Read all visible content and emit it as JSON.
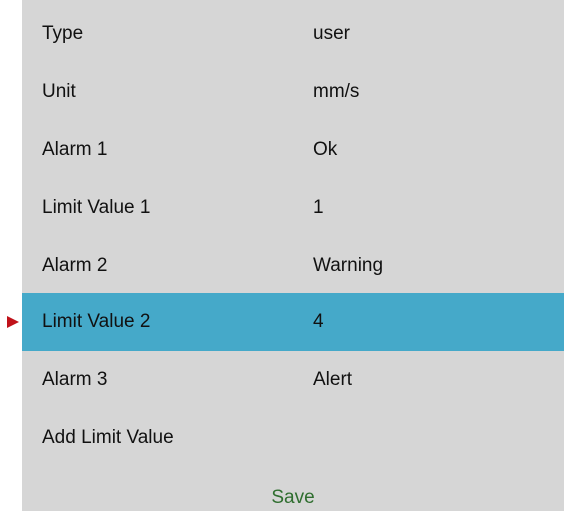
{
  "rows": [
    {
      "label": "Type",
      "value": "user"
    },
    {
      "label": "Unit",
      "value": "mm/s"
    },
    {
      "label": "Alarm 1",
      "value": "Ok"
    },
    {
      "label": "Limit Value 1",
      "value": "1"
    },
    {
      "label": "Alarm 2",
      "value": "Warning"
    },
    {
      "label": "Limit Value 2",
      "value": "4"
    },
    {
      "label": "Alarm 3",
      "value": "Alert"
    },
    {
      "label": "Add Limit Value",
      "value": ""
    }
  ],
  "selected_row": 5,
  "save_label": "Save",
  "colors": {
    "panel_background": "#d6d6d6",
    "selection": "#45a9c9",
    "pointer": "#c0121a",
    "save_text": "#2f6e2f"
  },
  "icons": {
    "selection_pointer": "triangle-right-icon"
  }
}
